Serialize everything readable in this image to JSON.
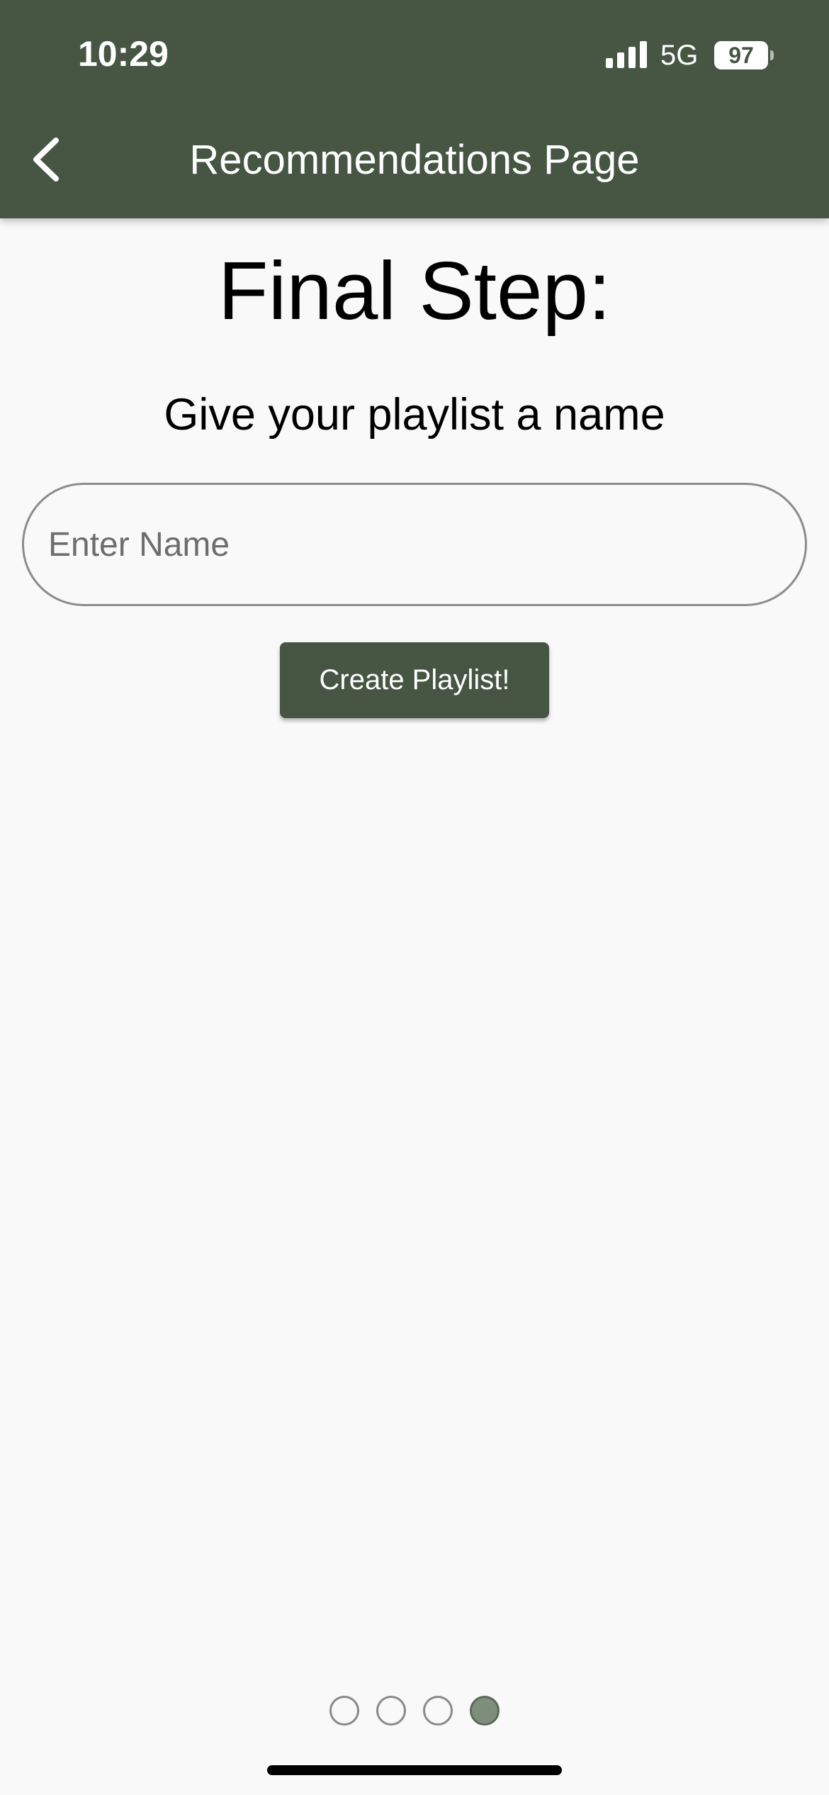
{
  "status_bar": {
    "time": "10:29",
    "network": "5G",
    "battery": "97",
    "icons": [
      "signal-icon",
      "battery-icon"
    ]
  },
  "header": {
    "title": "Recommendations Page",
    "back_icon": "chevron-left-icon",
    "background_color": "#465643"
  },
  "main": {
    "heading": "Final Step:",
    "subheading": "Give your playlist a name",
    "name_input": {
      "placeholder": "Enter Name",
      "value": ""
    },
    "create_button_label": "Create Playlist!",
    "accent_color": "#465643"
  },
  "pager": {
    "total": 4,
    "active_index": 3,
    "active_color": "#7d8e7a"
  }
}
